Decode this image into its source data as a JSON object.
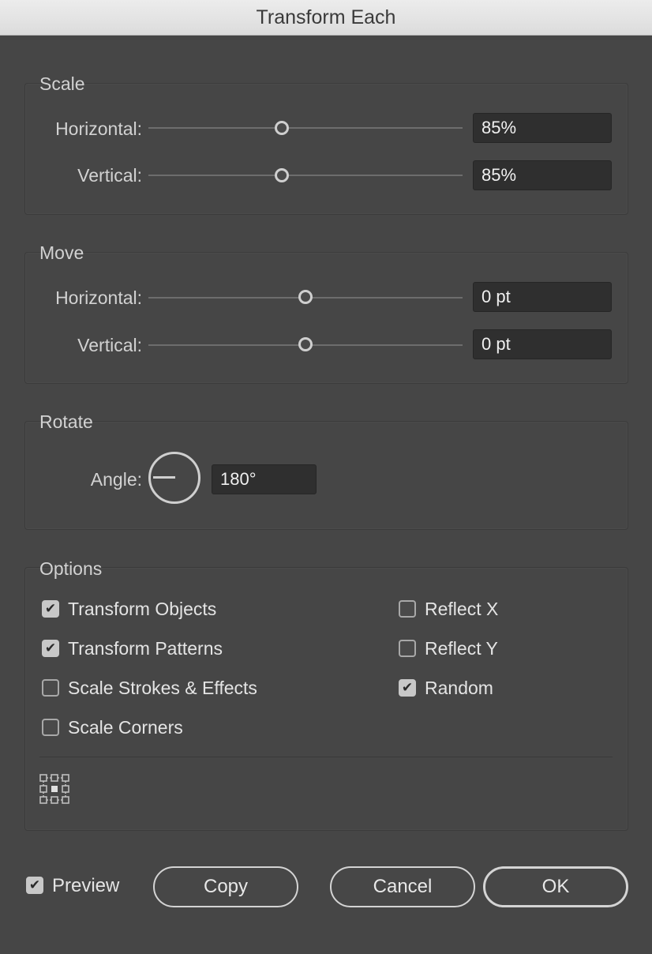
{
  "window": {
    "title": "Transform Each"
  },
  "scale": {
    "label": "Scale",
    "horizontal": {
      "label": "Horizontal:",
      "value": "85%",
      "slider_level": 0.43
    },
    "vertical": {
      "label": "Vertical:",
      "value": "85%",
      "slider_level": 0.43
    }
  },
  "move": {
    "label": "Move",
    "horizontal": {
      "label": "Horizontal:",
      "value": "0 pt",
      "slider_level": 0.5
    },
    "vertical": {
      "label": "Vertical:",
      "value": "0 pt",
      "slider_level": 0.5
    }
  },
  "rotate": {
    "label": "Rotate",
    "angle": {
      "label": "Angle:",
      "value": "180°"
    }
  },
  "options": {
    "label": "Options",
    "transform_objects": {
      "label": "Transform Objects",
      "checked": true
    },
    "transform_patterns": {
      "label": "Transform Patterns",
      "checked": true
    },
    "scale_strokes": {
      "label": "Scale Strokes & Effects",
      "checked": false
    },
    "scale_corners": {
      "label": "Scale Corners",
      "checked": false
    },
    "reflect_x": {
      "label": "Reflect X",
      "checked": false
    },
    "reflect_y": {
      "label": "Reflect Y",
      "checked": false
    },
    "random": {
      "label": "Random",
      "checked": true
    },
    "reference_point_icon": "reference-point-locator-icon"
  },
  "footer": {
    "preview": {
      "label": "Preview",
      "checked": true
    },
    "copy_label": "Copy",
    "cancel_label": "Cancel",
    "ok_label": "OK"
  },
  "colors": {
    "background": "#464646",
    "field": "#2f2f2f",
    "titlebar": "#e4e4e4"
  }
}
